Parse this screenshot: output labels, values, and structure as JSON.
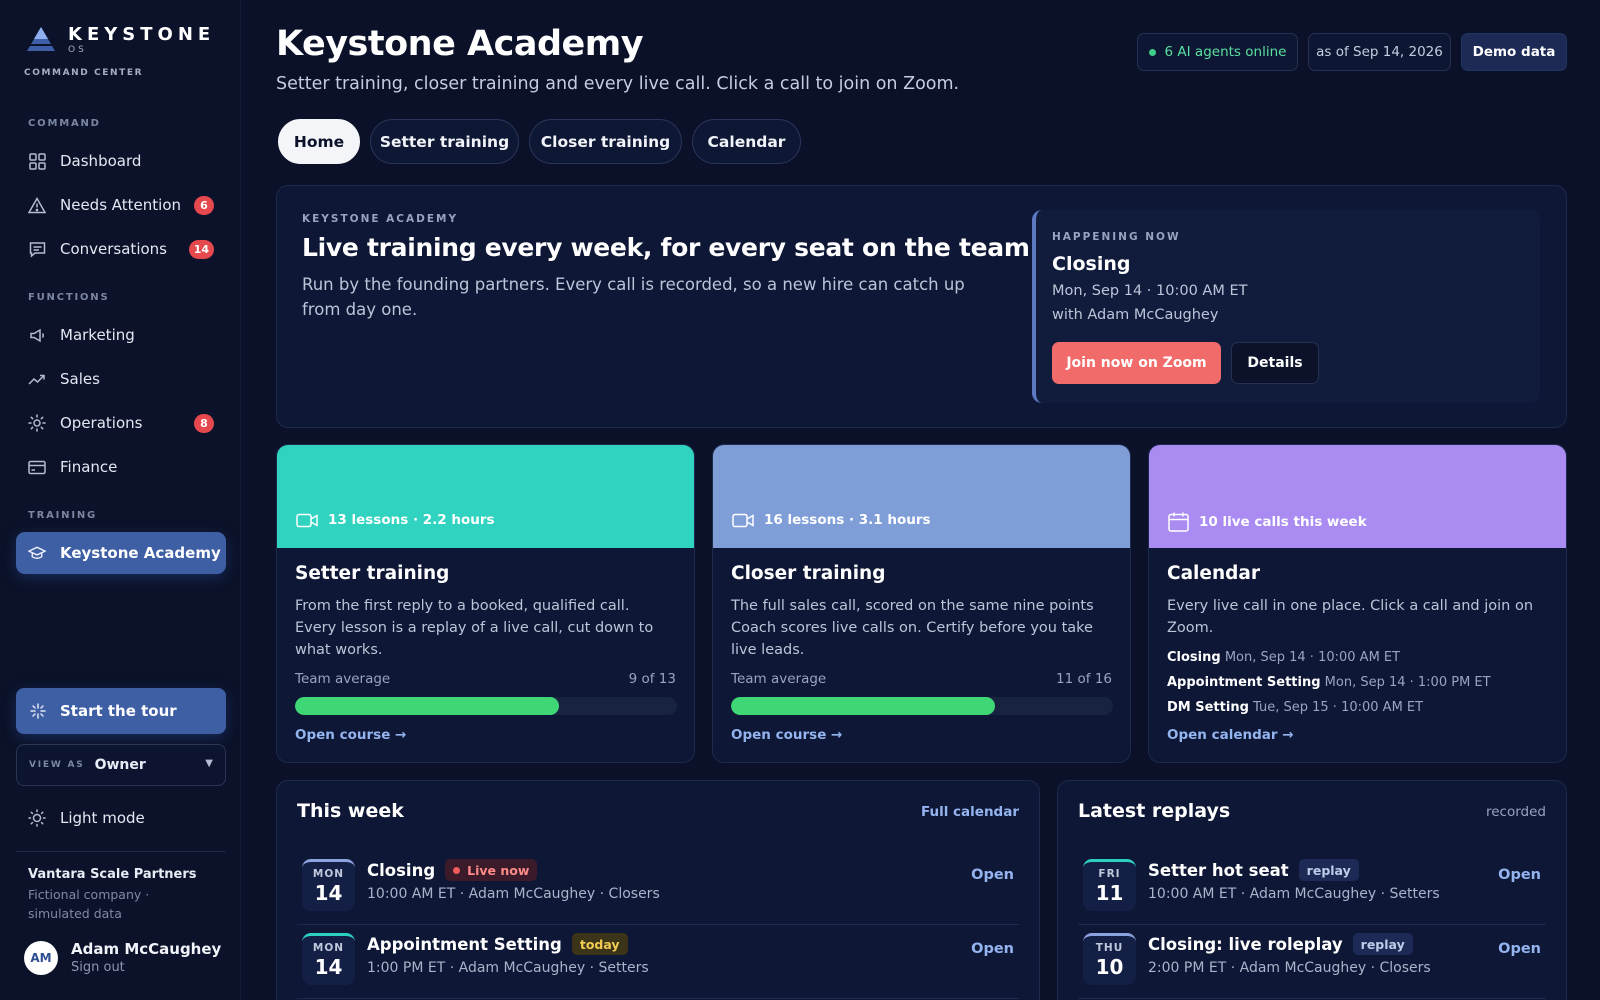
{
  "sidebar": {
    "logo_word": "KEYSTONE",
    "logo_os": "OS",
    "logo_sub": "COMMAND CENTER",
    "sections": {
      "command": "COMMAND",
      "functions": "FUNCTIONS",
      "training": "TRAINING"
    },
    "items": [
      {
        "label": "Dashboard",
        "icon": "grid-icon"
      },
      {
        "label": "Needs Attention",
        "icon": "warning-icon",
        "badge": "6"
      },
      {
        "label": "Conversations",
        "icon": "chat-icon",
        "badge": "14"
      },
      {
        "label": "Marketing",
        "icon": "megaphone-icon"
      },
      {
        "label": "Sales",
        "icon": "trending-up-icon"
      },
      {
        "label": "Operations",
        "icon": "gear-icon",
        "badge": "8"
      },
      {
        "label": "Finance",
        "icon": "credit-card-icon"
      },
      {
        "label": "Keystone Academy",
        "icon": "graduation-cap-icon",
        "active": true
      }
    ],
    "tour_label": "Start the tour",
    "view_as_label": "VIEW AS",
    "view_as_value": "Owner",
    "light_mode_label": "Light mode",
    "company_name": "Vantara Scale Partners",
    "company_desc": "Fictional company · simulated data",
    "user_initials": "AM",
    "user_name": "Adam McCaughey",
    "sign_out": "Sign out"
  },
  "header": {
    "title": "Keystone Academy",
    "subtitle": "Setter training, closer training and every live call. Click a call to join on Zoom.",
    "agents_online": "6 AI agents online",
    "as_of": "as of Sep 14, 2026",
    "demo": "Demo data",
    "colors": {
      "online": "#3fce8a"
    }
  },
  "tabs": [
    {
      "label": "Home",
      "active": true
    },
    {
      "label": "Setter training"
    },
    {
      "label": "Closer training"
    },
    {
      "label": "Calendar"
    }
  ],
  "hero": {
    "kicker": "KEYSTONE ACADEMY",
    "title": "Live training every week, for every seat on the team.",
    "desc": "Run by the founding partners. Every call is recorded, so a new hire can catch up from day one.",
    "now_kicker": "HAPPENING NOW",
    "now_title": "Closing",
    "now_when": "Mon, Sep 14 · 10:00 AM ET",
    "now_with": "with Adam McCaughey",
    "join_label": "Join now on Zoom",
    "details_label": "Details"
  },
  "courses": [
    {
      "meta": "13 lessons · 2.2 hours",
      "title": "Setter training",
      "desc": "From the first reply to a booked, qualified call. Every lesson is a replay of a live call, cut down to what works.",
      "avg_label": "Team average",
      "avg_value": "9 of 13",
      "progress": 0.69,
      "link": "Open course →",
      "color": "#2fd3c0"
    },
    {
      "meta": "16 lessons · 3.1 hours",
      "title": "Closer training",
      "desc": "The full sales call, scored on the same nine points Coach scores live calls on. Certify before you take live leads.",
      "avg_label": "Team average",
      "avg_value": "11 of 16",
      "progress": 0.69,
      "link": "Open course →",
      "color": "#7f9ed8"
    },
    {
      "meta": "10 live calls this week",
      "title": "Calendar",
      "desc": "Every live call in one place. Click a call and join on Zoom.",
      "events": [
        {
          "name": "Closing",
          "when": "Mon, Sep 14 · 10:00 AM ET"
        },
        {
          "name": "Appointment Setting",
          "when": "Mon, Sep 14 · 1:00 PM ET"
        },
        {
          "name": "DM Setting",
          "when": "Tue, Sep 15 · 10:00 AM ET"
        }
      ],
      "link": "Open calendar →",
      "color": "#a98bf1"
    }
  ],
  "this_week": {
    "title": "This week",
    "link": "Full calendar",
    "rows": [
      {
        "dow": "MON",
        "day": "14",
        "title": "Closing",
        "pill": "Live now",
        "meta": "10:00 AM ET · Adam McCaughey · Closers",
        "open": "Open"
      },
      {
        "dow": "MON",
        "day": "14",
        "title": "Appointment Setting",
        "pill": "today",
        "meta": "1:00 PM ET · Adam McCaughey · Setters",
        "open": "Open"
      }
    ]
  },
  "replays": {
    "title": "Latest replays",
    "link": "recorded",
    "rows": [
      {
        "dow": "FRI",
        "day": "11",
        "title": "Setter hot seat",
        "pill": "replay",
        "meta": "10:00 AM ET · Adam McCaughey · Setters",
        "open": "Open"
      },
      {
        "dow": "THU",
        "day": "10",
        "title": "Closing: live roleplay",
        "pill": "replay",
        "meta": "2:00 PM ET · Adam McCaughey · Closers",
        "open": "Open"
      }
    ]
  }
}
